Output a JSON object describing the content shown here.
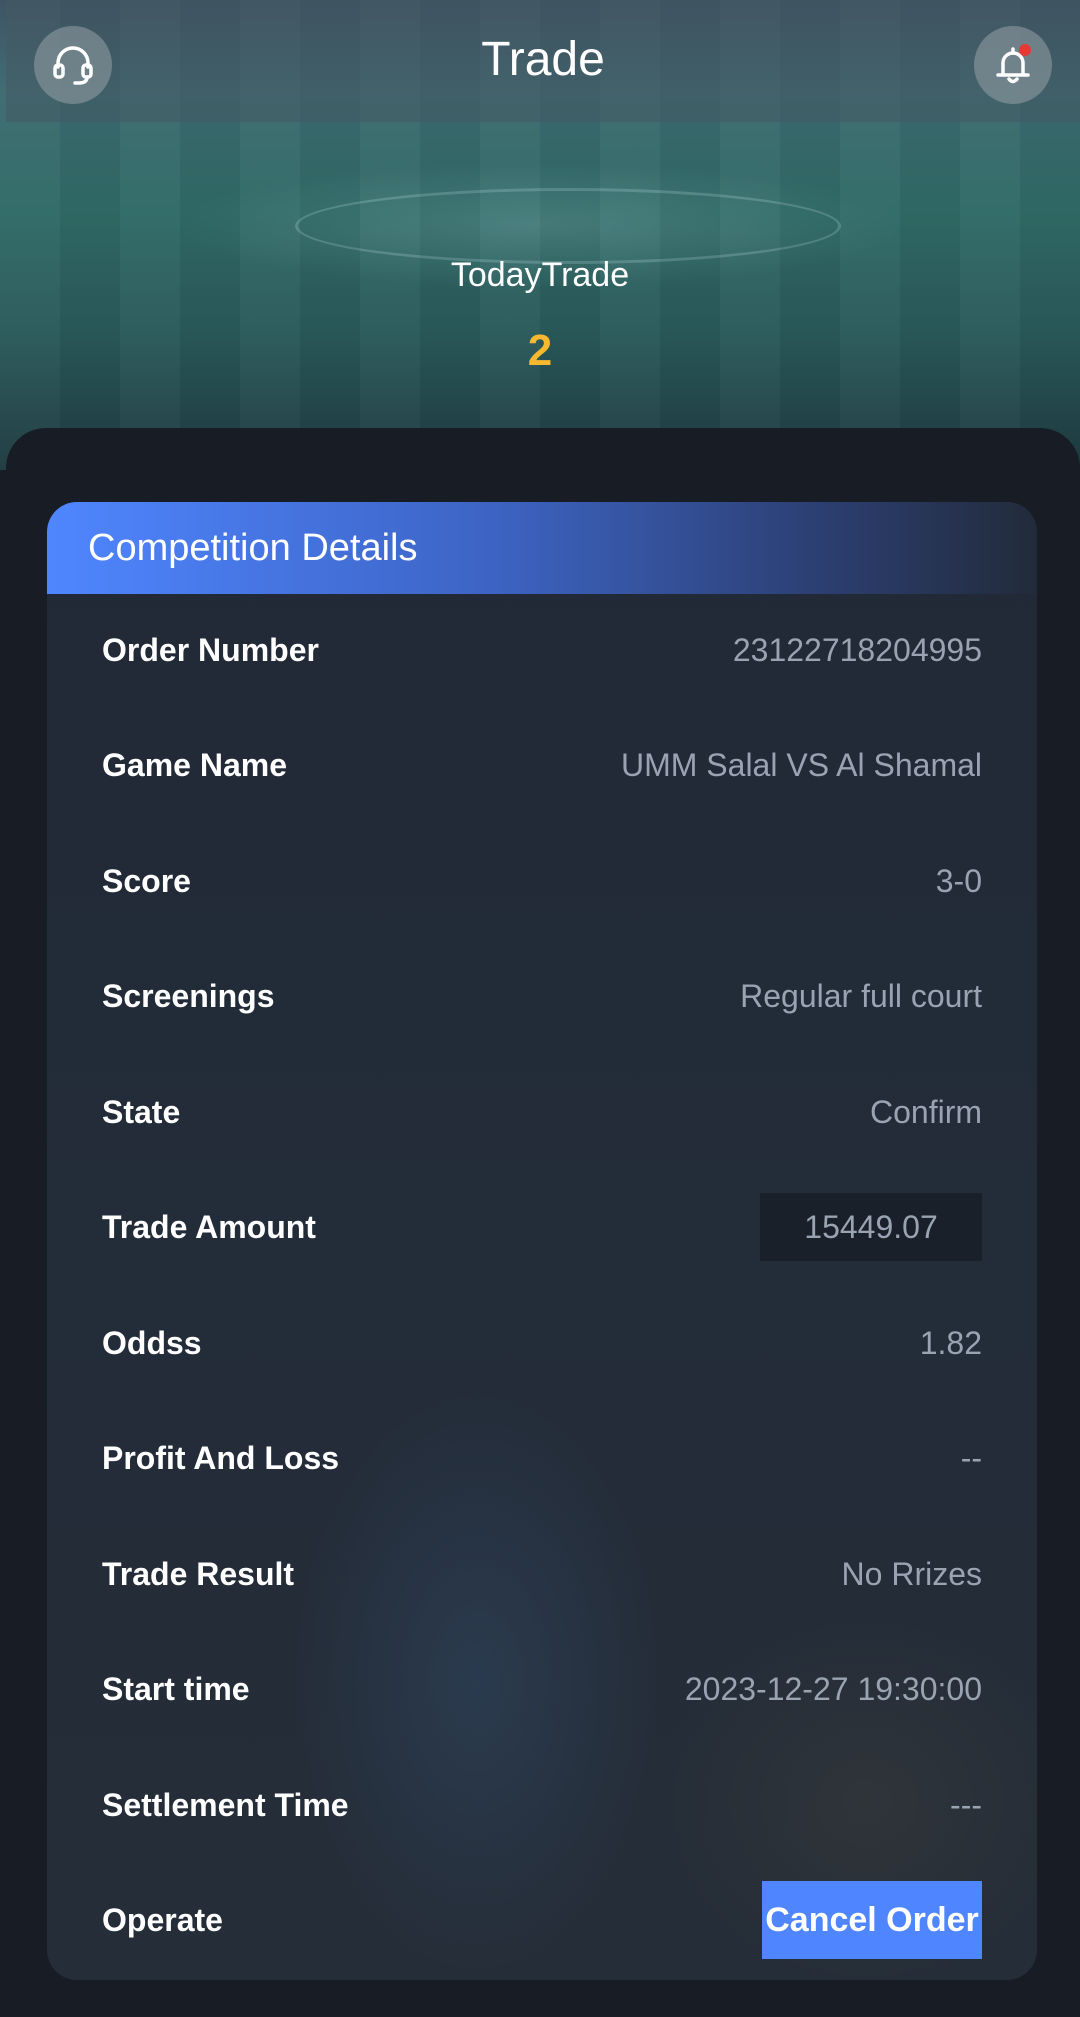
{
  "header": {
    "title": "Trade",
    "left_icon": "headset-icon",
    "right_icon": "bell-icon",
    "notification_dot_color": "#e53935"
  },
  "summary": {
    "label": "TodayTrade",
    "value": "2"
  },
  "card": {
    "title": "Competition Details",
    "rows": [
      {
        "label": "Order Number",
        "value": "23122718204995"
      },
      {
        "label": "Game Name",
        "value": "UMM Salal VS Al Shamal"
      },
      {
        "label": "Score",
        "value": "3-0"
      },
      {
        "label": "Screenings",
        "value": "Regular full court"
      },
      {
        "label": "State",
        "value": "Confirm"
      },
      {
        "label": "Trade Amount",
        "value": "15449.07"
      },
      {
        "label": "Oddss",
        "value": "1.82"
      },
      {
        "label": "Profit And Loss",
        "value": "--"
      },
      {
        "label": "Trade Result",
        "value": "No Rrizes"
      },
      {
        "label": "Start time",
        "value": "2023-12-27 19:30:00"
      },
      {
        "label": "Settlement Time",
        "value": "---"
      },
      {
        "label": "Operate",
        "value": "Cancel Order"
      }
    ]
  },
  "colors": {
    "accent": "#4f86ff",
    "highlight": "#f5b82e",
    "background": "#171c25"
  }
}
